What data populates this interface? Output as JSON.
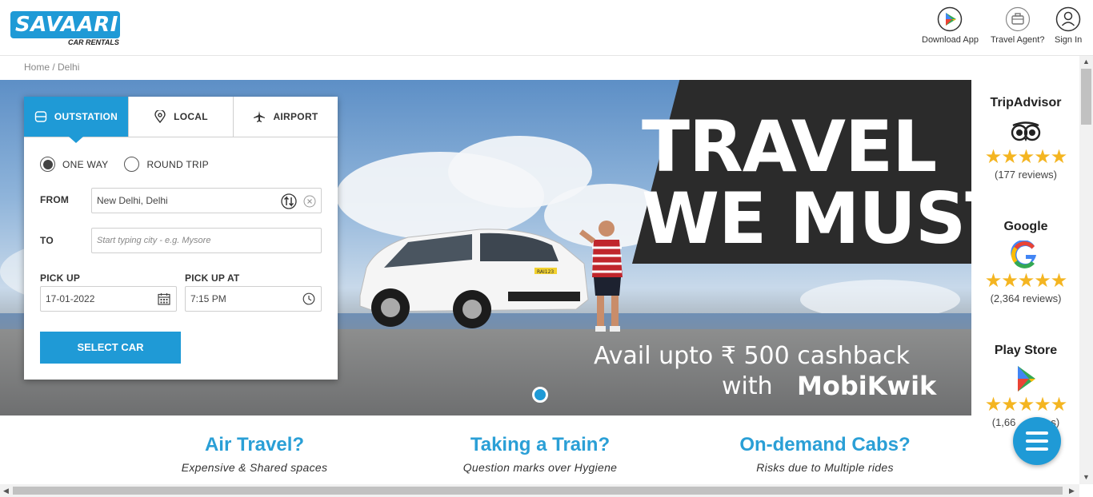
{
  "header": {
    "logo_text": "SAVAARI",
    "logo_subtext": "CAR RENTALS",
    "links": [
      {
        "label": "Download App",
        "icon": "play-store-icon"
      },
      {
        "label": "Travel Agent?",
        "icon": "briefcase-icon"
      },
      {
        "label": "Sign In",
        "icon": "user-icon"
      }
    ]
  },
  "breadcrumb": "Home / Delhi",
  "hero": {
    "headline_1": "TRAVEL",
    "headline_2": "WE MUST",
    "promo_line_1": "Avail upto ₹ 500 cashback",
    "promo_line_2": "with",
    "promo_brand": "MobiKwik",
    "plate": "RAI123"
  },
  "booking": {
    "tabs": [
      {
        "label": "OUTSTATION",
        "icon": "car-icon",
        "active": true
      },
      {
        "label": "LOCAL",
        "icon": "location-pin-icon",
        "active": false
      },
      {
        "label": "AIRPORT",
        "icon": "airplane-icon",
        "active": false
      }
    ],
    "trip_types": [
      {
        "label": "ONE WAY",
        "selected": true
      },
      {
        "label": "ROUND TRIP",
        "selected": false
      }
    ],
    "from_label": "FROM",
    "from_value": "New Delhi, Delhi",
    "to_label": "TO",
    "to_placeholder": "Start typing city - e.g. Mysore",
    "pickup_label": "PICK UP",
    "pickup_value": "17-01-2022",
    "pickup_at_label": "PICK UP AT",
    "pickup_at_value": "7:15 PM",
    "submit_label": "SELECT CAR"
  },
  "reviews": [
    {
      "name": "TripAdvisor",
      "stars": "★★★★★",
      "count": "(177 reviews)",
      "rating": 5.0
    },
    {
      "name": "Google",
      "stars": "★★★★★",
      "count": "(2,364 reviews)",
      "rating": 4.5
    },
    {
      "name": "Play Store",
      "stars": "★★★★★",
      "count": "(1,66",
      "count_tail": "s)",
      "rating": 4.5
    }
  ],
  "cards": [
    {
      "title": "Air Travel?",
      "subtitle": "Expensive & Shared spaces"
    },
    {
      "title": "Taking a Train?",
      "subtitle": "Question marks over Hygiene"
    },
    {
      "title": "On-demand Cabs?",
      "subtitle": "Risks due to Multiple rides"
    }
  ],
  "colors": {
    "brand": "#1f9ad6",
    "star": "#f4b521",
    "card_title": "#2a9fd6"
  }
}
